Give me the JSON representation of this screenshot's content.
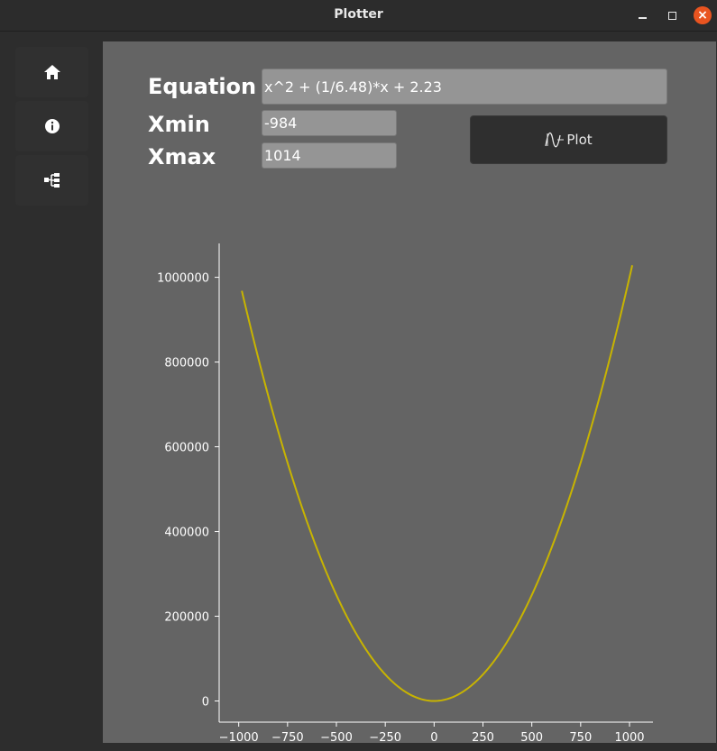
{
  "window": {
    "title": "Plotter"
  },
  "sidebar": {
    "items": [
      {
        "icon": "home-icon"
      },
      {
        "icon": "info-icon"
      },
      {
        "icon": "tree-icon"
      }
    ]
  },
  "form": {
    "equation_label": "Equation",
    "equation_value": "x^2 + (1/6.48)*x + 2.23",
    "xmin_label": "Xmin",
    "xmin_value": "-984",
    "xmax_label": "Xmax",
    "xmax_value": "1014",
    "plot_button_label": "Plot"
  },
  "colors": {
    "panel_bg": "#646464",
    "curve": "#c8b400",
    "axis": "#ffffff",
    "close_button": "#e95420"
  },
  "chart_data": {
    "type": "line",
    "function": "x^2 + (1/6.48)*x + 2.23",
    "x_range": [
      -984,
      1014
    ],
    "xlim": [
      -1100,
      1120
    ],
    "ylim": [
      -50000,
      1080000
    ],
    "x_ticks": [
      -1000,
      -750,
      -500,
      -250,
      0,
      250,
      500,
      750,
      1000
    ],
    "x_tick_labels": [
      "−1000",
      "−750",
      "−500",
      "−250",
      "0",
      "250",
      "500",
      "750",
      "1000"
    ],
    "y_ticks": [
      0,
      200000,
      400000,
      600000,
      800000,
      1000000
    ],
    "y_tick_labels": [
      "0",
      "200000",
      "400000",
      "600000",
      "800000",
      "1000000"
    ],
    "grid": false
  }
}
